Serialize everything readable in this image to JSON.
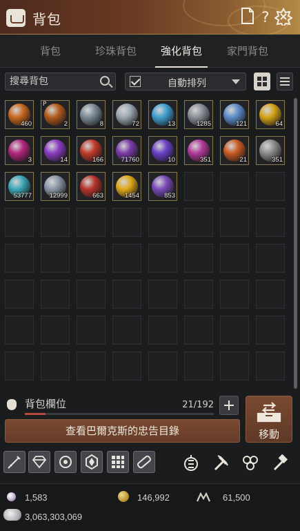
{
  "header": {
    "title": "背包"
  },
  "tabs": [
    {
      "label": "背包",
      "active": false
    },
    {
      "label": "珍珠背包",
      "active": false
    },
    {
      "label": "強化背包",
      "active": true
    },
    {
      "label": "家門背包",
      "active": false
    }
  ],
  "search": {
    "placeholder": "搜尋背包"
  },
  "sort": {
    "checked": true,
    "label": "自動排列"
  },
  "items": [
    {
      "qty": "460",
      "color": "#c8681e",
      "tag": ""
    },
    {
      "qty": "2",
      "color": "#b25a1c",
      "tag": "P"
    },
    {
      "qty": "8",
      "color": "#7b8a96",
      "tag": ""
    },
    {
      "qty": "72",
      "color": "#9aa6ae",
      "tag": ""
    },
    {
      "qty": "13",
      "color": "#3f9fd0",
      "tag": ""
    },
    {
      "qty": "1285",
      "color": "#8a8f98",
      "tag": ""
    },
    {
      "qty": "121",
      "color": "#5c8cc8",
      "tag": ""
    },
    {
      "qty": "64",
      "color": "#d4a318",
      "tag": ""
    },
    {
      "qty": "3",
      "color": "#b2267e",
      "tag": ""
    },
    {
      "qty": "14",
      "color": "#8a3cc0",
      "tag": ""
    },
    {
      "qty": "166",
      "color": "#c03a2a",
      "tag": ""
    },
    {
      "qty": "71760",
      "color": "#7a3aa8",
      "tag": ""
    },
    {
      "qty": "10",
      "color": "#6a40c8",
      "tag": ""
    },
    {
      "qty": "351",
      "color": "#b03a9a",
      "tag": ""
    },
    {
      "qty": "21",
      "color": "#c85a22",
      "tag": ""
    },
    {
      "qty": "351",
      "color": "#8c8c8c",
      "tag": ""
    },
    {
      "qty": "53777",
      "color": "#3aa8b8",
      "tag": ""
    },
    {
      "qty": "12999",
      "color": "#8a96a6",
      "tag": ""
    },
    {
      "qty": "663",
      "color": "#b8342a",
      "tag": ""
    },
    {
      "qty": "1454",
      "color": "#e0a818",
      "tag": ""
    },
    {
      "qty": "853",
      "color": "#7a4ab8",
      "tag": ""
    }
  ],
  "capacity": {
    "label": "背包欄位",
    "count": "21/192",
    "fill_fraction": 0.109
  },
  "advice_button": "查看巴爾克斯的忠告目錄",
  "move_button": "移動",
  "currency": {
    "pearl": "1,583",
    "gold": "146,992",
    "energy": "61,500",
    "silver": "3,063,303,069"
  }
}
